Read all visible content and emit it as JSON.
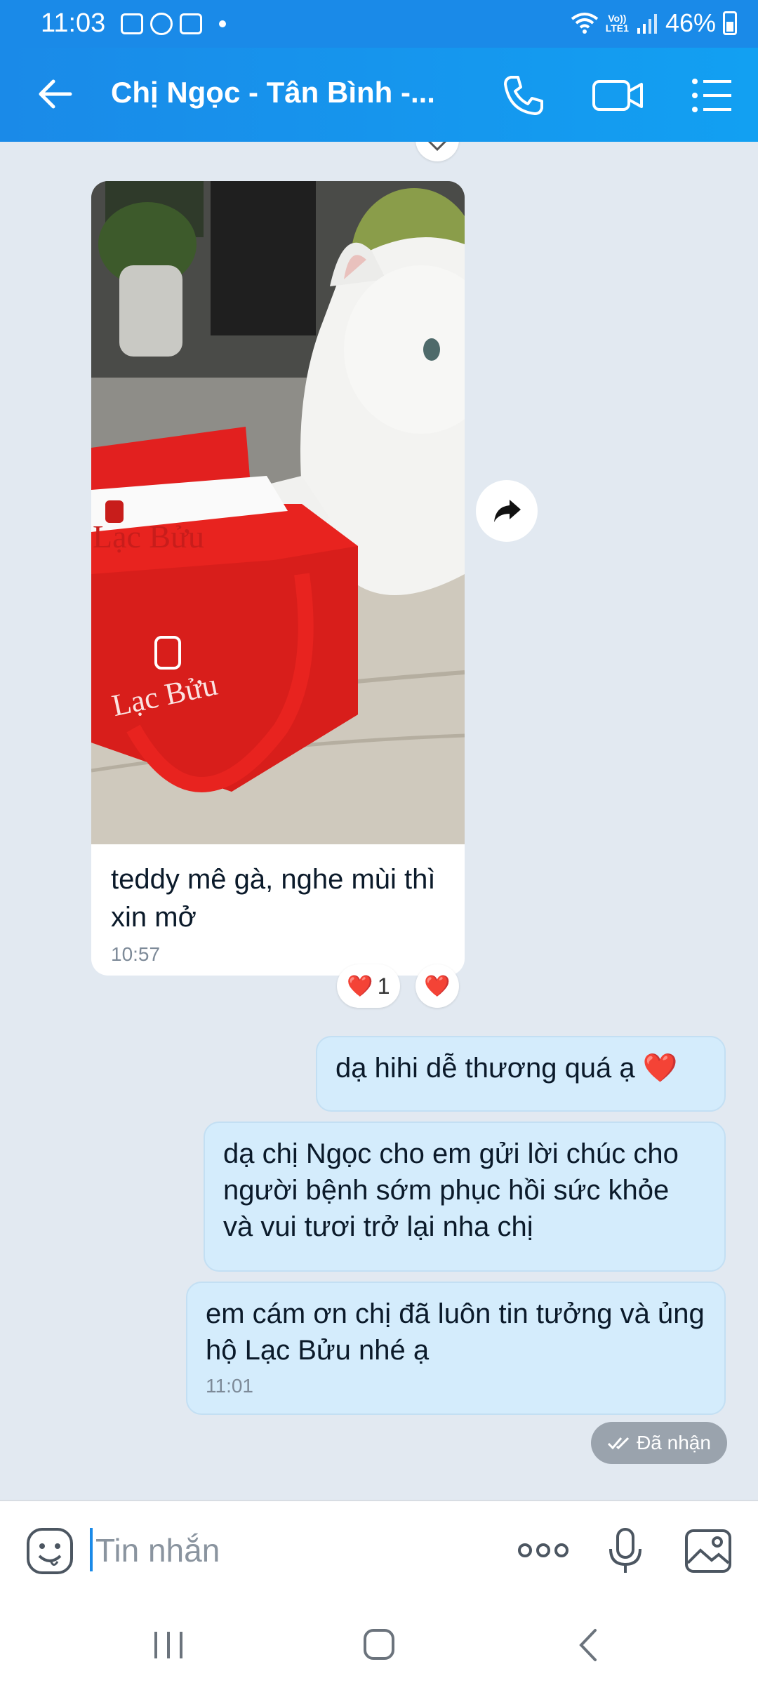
{
  "status_bar": {
    "time": "11:03",
    "network_line1": "Vo))",
    "network_line2": "LTE1",
    "battery": "46%"
  },
  "header": {
    "title": "Chị Ngọc - Tân Bình -...",
    "back_icon": "back-arrow-icon",
    "call_icon": "phone-icon",
    "video_icon": "video-call-icon",
    "menu_icon": "list-menu-icon"
  },
  "messages": {
    "incoming_photo": {
      "caption": "teddy mê gà, nghe mùi thì xin mở",
      "time": "10:57",
      "photo_description_icon": "cat-with-red-bag-photo",
      "reaction_count": "1",
      "reaction_emoji": "❤️"
    },
    "outgoing": [
      {
        "text": "dạ hihi dễ thương quá ạ ❤️"
      },
      {
        "text": "dạ chị Ngọc cho em gửi lời chúc cho người bệnh sớm phục hồi sức khỏe và vui tươi trở lại nha chị"
      },
      {
        "text": "em cám ơn chị đã luôn tin tưởng và ủng hộ Lạc Bửu nhé ạ",
        "time": "11:01"
      }
    ],
    "status": "Đã nhận",
    "photo_text": {
      "brand": "Lạc Bửu"
    }
  },
  "input": {
    "placeholder": "Tin nhắn"
  },
  "colors": {
    "accent": "#1a8ae8",
    "outgoing_bubble": "#d4ecfc",
    "background": "#e2e9f1",
    "heart": "#e0182d"
  }
}
